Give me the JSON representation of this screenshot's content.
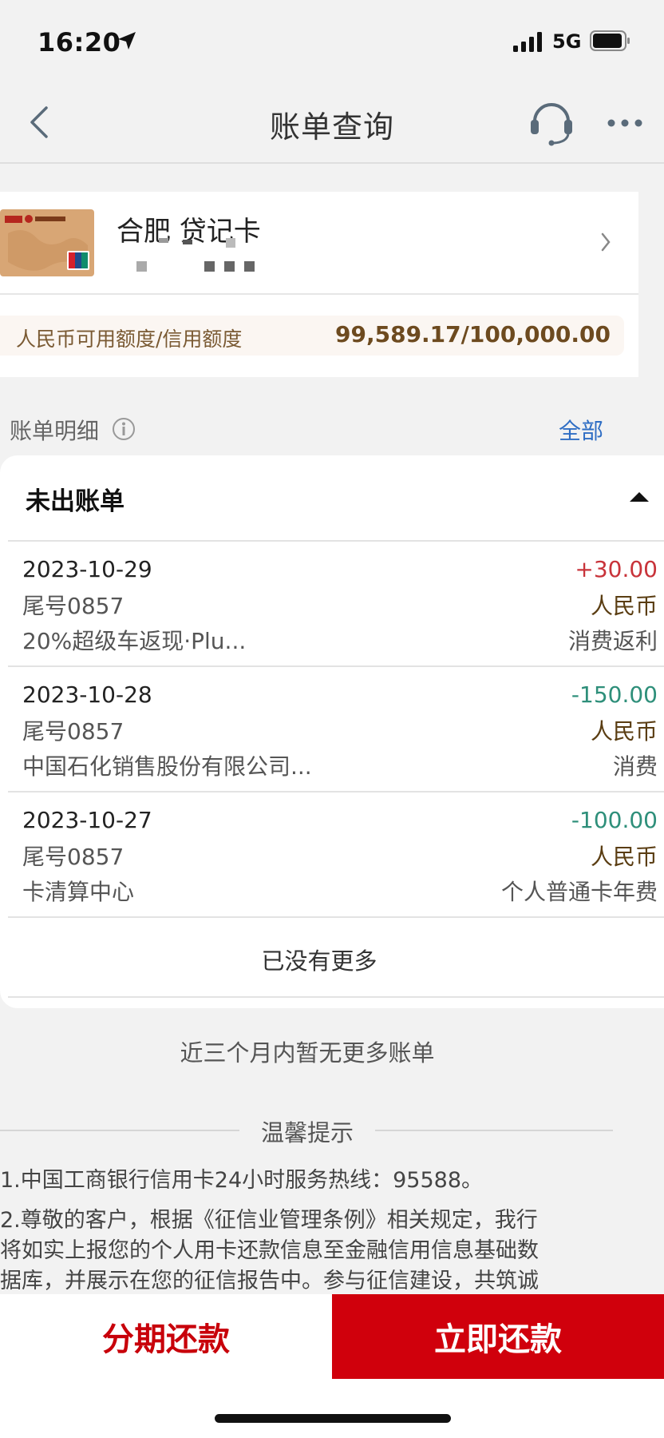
{
  "status_bar": {
    "time": "16:20",
    "network": "5G"
  },
  "nav": {
    "title": "账单查询"
  },
  "card": {
    "name": "合肥 贷记卡",
    "limit_label": "人民币可用额度/信用额度",
    "limit_value": "99,589.17/100,000.00"
  },
  "detail": {
    "label": "账单明细",
    "all_link": "全部"
  },
  "unbilled": {
    "title": "未出账单",
    "transactions": [
      {
        "date": "2023-10-29",
        "card_tail": "尾号0857",
        "merchant": "20%超级车返现·Plu...",
        "amount": "+30.00",
        "currency": "人民币",
        "type": "消费返利"
      },
      {
        "date": "2023-10-28",
        "card_tail": "尾号0857",
        "merchant": "中国石化销售股份有限公司...",
        "amount": "-150.00",
        "currency": "人民币",
        "type": "消费"
      },
      {
        "date": "2023-10-27",
        "card_tail": "尾号0857",
        "merchant": "卡清算中心",
        "amount": "-100.00",
        "currency": "人民币",
        "type": "个人普通卡年费"
      }
    ],
    "no_more": "已没有更多"
  },
  "no_more_3m": "近三个月内暂无更多账单",
  "tips": {
    "title": "温馨提示",
    "line1": "1.中国工商银行信用卡24小时服务热线：95588。",
    "line2a": "2.尊敬的客户，根据《征信业管理条例》相关规定，我行",
    "line2b": "将如实上报您的个人用卡还款信息至金融信用信息基础数",
    "line2c": "据库，并展示在您的征信报告中。参与征信建设，共筑诚"
  },
  "actions": {
    "installment": "分期还款",
    "pay_now": "立即还款"
  },
  "colors": {
    "income": "#c8333a",
    "expense": "#2e8f7a",
    "accent_red": "#d0000c",
    "link_blue": "#2f6ec4"
  }
}
